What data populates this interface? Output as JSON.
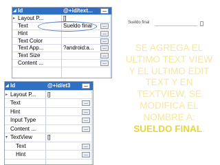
{
  "top_properties": {
    "rows": [
      {
        "key": "Id",
        "value": "@+id/text...",
        "head": true
      },
      {
        "key": "Layout P...",
        "value": "[]"
      },
      {
        "key": "Text",
        "value": "Sueldo final"
      },
      {
        "key": "Hint",
        "value": ""
      },
      {
        "key": "Text Color",
        "value": ""
      },
      {
        "key": "Text App...",
        "value": "?android:a..."
      },
      {
        "key": "Text Size",
        "value": ""
      },
      {
        "key": "Content ...",
        "value": ""
      }
    ]
  },
  "bottom_properties": {
    "rows": [
      {
        "key": "Id",
        "value": "@+id/et3",
        "head": true
      },
      {
        "key": "Layout P...",
        "value": "[]"
      },
      {
        "key": "Text",
        "value": ""
      },
      {
        "key": "Hint",
        "value": ""
      },
      {
        "key": "Input Type",
        "value": ""
      },
      {
        "key": "Content ...",
        "value": ""
      },
      {
        "key": "TextView",
        "value": "[]"
      },
      {
        "key": "Text",
        "value": ""
      },
      {
        "key": "Hint",
        "value": ""
      }
    ]
  },
  "dots_label": "...",
  "preview": {
    "label": "Sueldo final"
  },
  "caption": {
    "text": "SE AGREGA EL ULTIMO TEXT VIEW Y EL ULTIMO EDIT TEXT Y EN TEXTVIEW, SE MODIFICA EL NOMBRE A:",
    "accent": "SUELDO FINAL",
    "end": "."
  },
  "colors": {
    "header": "#2f6fc4",
    "caption": "#f5e6a0",
    "accent": "#e8d53a"
  }
}
